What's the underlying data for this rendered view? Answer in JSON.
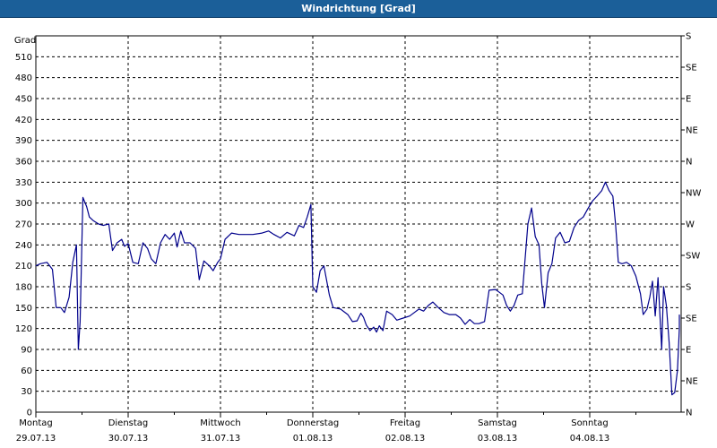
{
  "window": {
    "title": "Windrichtung [Grad]"
  },
  "colors": {
    "titlebar": "#1b5f99",
    "line": "#00008b",
    "grid": "#000000"
  },
  "chart_data": {
    "type": "line",
    "title": "Windrichtung [Grad]",
    "ylabel": "Grad",
    "ylim": [
      0,
      540
    ],
    "grid": true,
    "y_ticks": [
      0,
      30,
      60,
      90,
      120,
      150,
      180,
      210,
      240,
      270,
      300,
      330,
      360,
      390,
      420,
      450,
      480,
      510
    ],
    "right_axis_labels": [
      "N",
      "NE",
      "E",
      "SE",
      "S",
      "SW",
      "W",
      "NW",
      "N",
      "NE",
      "E",
      "SE",
      "S"
    ],
    "x_ticks": [
      {
        "day": "Montag",
        "date": "29.07.13"
      },
      {
        "day": "Dienstag",
        "date": "30.07.13"
      },
      {
        "day": "Mittwoch",
        "date": "31.07.13"
      },
      {
        "day": "Donnerstag",
        "date": "01.08.13"
      },
      {
        "day": "Freitag",
        "date": "02.08.13"
      },
      {
        "day": "Samstag",
        "date": "03.08.13"
      },
      {
        "day": "Sonntag",
        "date": "04.08.13"
      }
    ],
    "xlim_days": [
      0,
      7
    ],
    "series": [
      {
        "values": [
          [
            0.0,
            210
          ],
          [
            0.05,
            213
          ],
          [
            0.12,
            215
          ],
          [
            0.18,
            205
          ],
          [
            0.22,
            150
          ],
          [
            0.27,
            150
          ],
          [
            0.31,
            143
          ],
          [
            0.36,
            165
          ],
          [
            0.4,
            215
          ],
          [
            0.44,
            240
          ],
          [
            0.46,
            90
          ],
          [
            0.48,
            130
          ],
          [
            0.51,
            308
          ],
          [
            0.55,
            295
          ],
          [
            0.58,
            280
          ],
          [
            0.62,
            275
          ],
          [
            0.68,
            270
          ],
          [
            0.73,
            268
          ],
          [
            0.79,
            270
          ],
          [
            0.83,
            232
          ],
          [
            0.88,
            243
          ],
          [
            0.93,
            248
          ],
          [
            0.96,
            238
          ],
          [
            1.0,
            242
          ],
          [
            1.05,
            215
          ],
          [
            1.11,
            213
          ],
          [
            1.16,
            243
          ],
          [
            1.21,
            235
          ],
          [
            1.25,
            220
          ],
          [
            1.3,
            213
          ],
          [
            1.35,
            243
          ],
          [
            1.4,
            255
          ],
          [
            1.45,
            248
          ],
          [
            1.5,
            257
          ],
          [
            1.53,
            237
          ],
          [
            1.57,
            260
          ],
          [
            1.61,
            243
          ],
          [
            1.67,
            243
          ],
          [
            1.73,
            235
          ],
          [
            1.77,
            190
          ],
          [
            1.82,
            217
          ],
          [
            1.88,
            210
          ],
          [
            1.92,
            203
          ],
          [
            1.97,
            215
          ],
          [
            2.0,
            220
          ],
          [
            2.05,
            248
          ],
          [
            2.12,
            257
          ],
          [
            2.2,
            255
          ],
          [
            2.35,
            255
          ],
          [
            2.45,
            257
          ],
          [
            2.52,
            260
          ],
          [
            2.58,
            255
          ],
          [
            2.65,
            250
          ],
          [
            2.72,
            258
          ],
          [
            2.8,
            253
          ],
          [
            2.85,
            268
          ],
          [
            2.9,
            265
          ],
          [
            2.94,
            280
          ],
          [
            2.98,
            298
          ],
          [
            3.0,
            180
          ],
          [
            3.04,
            172
          ],
          [
            3.08,
            203
          ],
          [
            3.12,
            210
          ],
          [
            3.18,
            168
          ],
          [
            3.22,
            150
          ],
          [
            3.3,
            148
          ],
          [
            3.38,
            140
          ],
          [
            3.43,
            130
          ],
          [
            3.48,
            131
          ],
          [
            3.52,
            142
          ],
          [
            3.55,
            136
          ],
          [
            3.58,
            125
          ],
          [
            3.62,
            117
          ],
          [
            3.66,
            122
          ],
          [
            3.69,
            115
          ],
          [
            3.72,
            124
          ],
          [
            3.76,
            117
          ],
          [
            3.8,
            145
          ],
          [
            3.86,
            140
          ],
          [
            3.91,
            132
          ],
          [
            3.98,
            135
          ],
          [
            4.05,
            138
          ],
          [
            4.1,
            143
          ],
          [
            4.15,
            148
          ],
          [
            4.2,
            145
          ],
          [
            4.25,
            153
          ],
          [
            4.3,
            158
          ],
          [
            4.36,
            150
          ],
          [
            4.42,
            143
          ],
          [
            4.48,
            140
          ],
          [
            4.55,
            140
          ],
          [
            4.6,
            135
          ],
          [
            4.65,
            126
          ],
          [
            4.7,
            133
          ],
          [
            4.75,
            127
          ],
          [
            4.8,
            127
          ],
          [
            4.86,
            130
          ],
          [
            4.91,
            175
          ],
          [
            4.98,
            176
          ],
          [
            5.02,
            172
          ],
          [
            5.06,
            168
          ],
          [
            5.1,
            153
          ],
          [
            5.14,
            145
          ],
          [
            5.18,
            153
          ],
          [
            5.22,
            168
          ],
          [
            5.27,
            170
          ],
          [
            5.33,
            270
          ],
          [
            5.37,
            293
          ],
          [
            5.41,
            252
          ],
          [
            5.45,
            240
          ],
          [
            5.48,
            185
          ],
          [
            5.51,
            150
          ],
          [
            5.55,
            200
          ],
          [
            5.59,
            213
          ],
          [
            5.63,
            250
          ],
          [
            5.68,
            258
          ],
          [
            5.73,
            243
          ],
          [
            5.78,
            245
          ],
          [
            5.83,
            265
          ],
          [
            5.88,
            275
          ],
          [
            5.93,
            280
          ],
          [
            5.98,
            292
          ],
          [
            6.03,
            303
          ],
          [
            6.08,
            310
          ],
          [
            6.13,
            318
          ],
          [
            6.17,
            330
          ],
          [
            6.21,
            318
          ],
          [
            6.25,
            310
          ],
          [
            6.28,
            270
          ],
          [
            6.31,
            215
          ],
          [
            6.35,
            213
          ],
          [
            6.4,
            215
          ],
          [
            6.45,
            210
          ],
          [
            6.5,
            195
          ],
          [
            6.55,
            170
          ],
          [
            6.58,
            140
          ],
          [
            6.62,
            148
          ],
          [
            6.65,
            165
          ],
          [
            6.68,
            188
          ],
          [
            6.71,
            138
          ],
          [
            6.74,
            193
          ],
          [
            6.78,
            90
          ],
          [
            6.8,
            180
          ],
          [
            6.83,
            153
          ],
          [
            6.86,
            100
          ],
          [
            6.89,
            25
          ],
          [
            6.92,
            28
          ],
          [
            6.95,
            60
          ],
          [
            6.98,
            120
          ],
          [
            7.0,
            140
          ]
        ]
      }
    ]
  }
}
